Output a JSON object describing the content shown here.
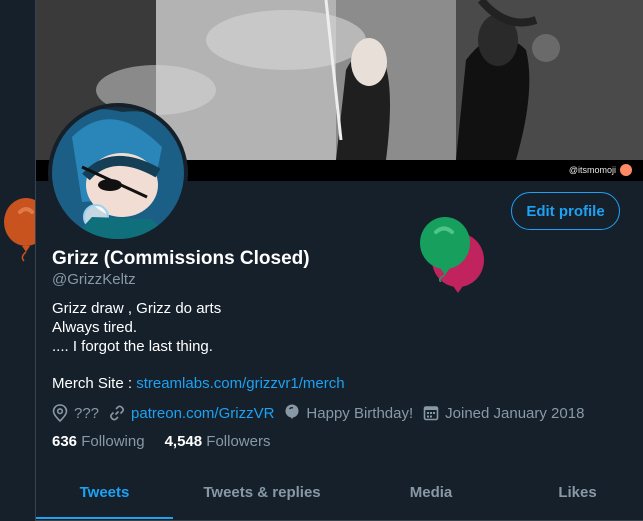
{
  "banner": {
    "watermark": "@itsmomoji"
  },
  "profile": {
    "edit_label": "Edit profile",
    "name": "Grizz (Commissions Closed)",
    "handle": "@GrizzKeltz",
    "bio_lines": [
      "Grizz draw , Grizz do arts",
      "Always tired.",
      ".... I forgot the last thing."
    ],
    "merch_label": "Merch Site : ",
    "merch_link": "streamlabs.com/grizzvr1/merch",
    "location": "???",
    "website": "patreon.com/GrizzVR",
    "birthday": "Happy Birthday!",
    "joined": "Joined January 2018",
    "following_count": "636",
    "following_label": "Following",
    "followers_count": "4,548",
    "followers_label": "Followers"
  },
  "tabs": [
    {
      "label": "Tweets",
      "active": true
    },
    {
      "label": "Tweets & replies",
      "active": false
    },
    {
      "label": "Media",
      "active": false
    },
    {
      "label": "Likes",
      "active": false
    }
  ],
  "icons": {
    "location": "location-pin-icon",
    "website": "link-icon",
    "birthday": "balloon-icon",
    "joined": "calendar-icon"
  },
  "colors": {
    "background": "#15202b",
    "accent": "#1da1f2",
    "muted": "#8899a6",
    "balloon_orange": "#c8531f",
    "balloon_green": "#17a05d",
    "balloon_magenta": "#c0235e"
  }
}
